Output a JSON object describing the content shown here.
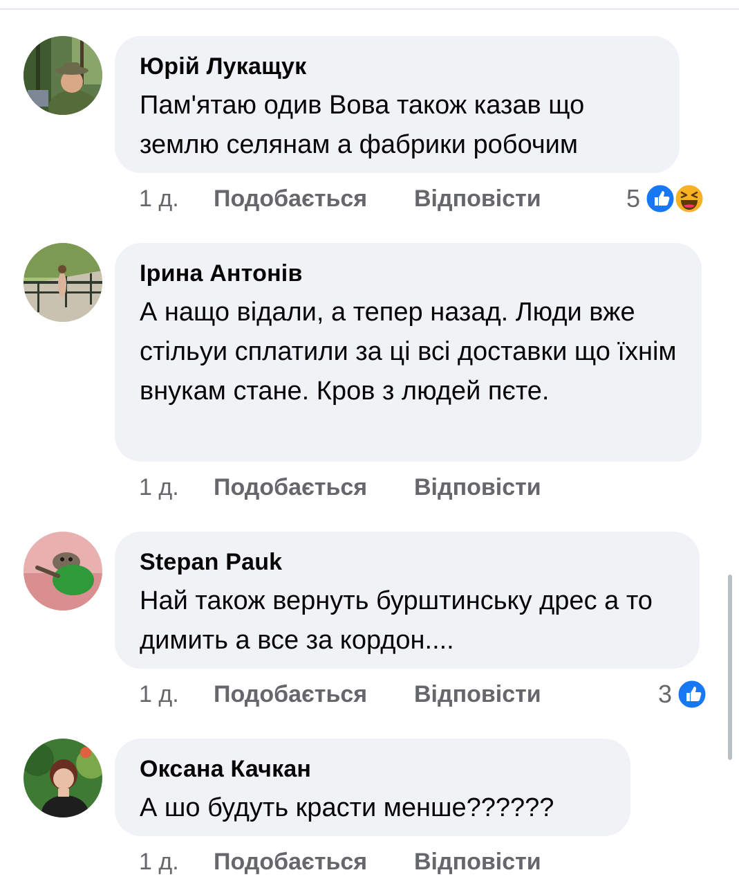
{
  "comments": [
    {
      "author": "Юрій Лукащук",
      "text": "Пам'ятаю одив Вова також казав що землю селянам а фабрики робочим",
      "time": "1 д.",
      "like_label": "Подобається",
      "reply_label": "Відповісти",
      "reaction_count": "5",
      "reactions": [
        "like-icon",
        "haha-icon"
      ]
    },
    {
      "author": "Ірина Антонів",
      "text": "А нащо відали, а тепер назад. Люди вже стільуи сплатили за ці всі доставки що їхнім внукам стане. Кров з людей пєте.",
      "time": "1 д.",
      "like_label": "Подобається",
      "reply_label": "Відповісти"
    },
    {
      "author": "Stepan Pauk",
      "text": "Най також вернуть бурштинську дрес а то димить а все за кордон....",
      "time": "1 д.",
      "like_label": "Подобається",
      "reply_label": "Відповісти",
      "reaction_count": "3",
      "reactions": [
        "like-icon"
      ]
    },
    {
      "author": "Оксана Качкан",
      "text": "А шо будуть красти менше??????",
      "time": "1 д.",
      "like_label": "Подобається",
      "reply_label": "Відповісти"
    }
  ],
  "colors": {
    "bubble": "#f0f2f5",
    "meta_text": "#65676b",
    "like_blue": "#1877f2",
    "haha_yellow": "#f7b125"
  }
}
